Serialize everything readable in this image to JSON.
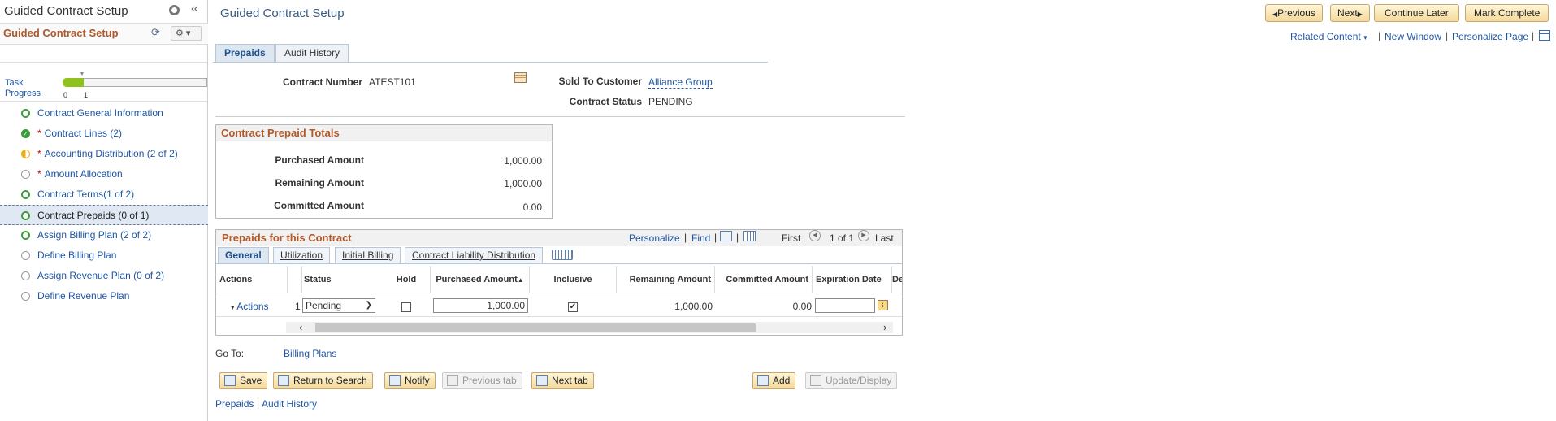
{
  "left_panel": {
    "title": "Guided Contract Setup",
    "subtitle": "Guided Contract Setup",
    "task_progress": {
      "label_line1": "Task",
      "label_line2": "Progress",
      "tick0": "0",
      "tick1": "1"
    },
    "items": [
      {
        "label": "Contract General Information",
        "required": false,
        "status": "open"
      },
      {
        "label": "Contract Lines (2)",
        "required": true,
        "status": "complete"
      },
      {
        "label": "Accounting Distribution (2 of 2)",
        "required": true,
        "status": "partial"
      },
      {
        "label": "Amount Allocation",
        "required": true,
        "status": "notstarted"
      },
      {
        "label": "Contract Terms(1 of 2)",
        "required": false,
        "status": "open"
      },
      {
        "label": "Contract Prepaids (0 of 1)",
        "required": false,
        "status": "open",
        "active": true
      },
      {
        "label": "Assign Billing Plan (2 of 2)",
        "required": false,
        "status": "open"
      },
      {
        "label": "Define Billing Plan",
        "required": false,
        "status": "notstarted"
      },
      {
        "label": "Assign Revenue Plan (0 of 2)",
        "required": false,
        "status": "notstarted"
      },
      {
        "label": "Define Revenue Plan",
        "required": false,
        "status": "notstarted"
      }
    ],
    "required_mark": "*"
  },
  "header": {
    "title": "Guided Contract Setup",
    "previous": "Previous",
    "next": "Next",
    "continue_later": "Continue Later",
    "mark_complete": "Mark Complete",
    "related_content": "Related Content",
    "new_window": "New Window",
    "personalize_page": "Personalize Page"
  },
  "tabs": {
    "prepaids": "Prepaids",
    "audit_history": "Audit History"
  },
  "contract": {
    "number_label": "Contract Number",
    "number": "ATEST101",
    "sold_to_label": "Sold To Customer",
    "sold_to": "Alliance Group",
    "status_label": "Contract Status",
    "status": "PENDING"
  },
  "totals": {
    "title": "Contract Prepaid Totals",
    "purchased_label": "Purchased Amount",
    "purchased": "1,000.00",
    "remaining_label": "Remaining Amount",
    "remaining": "1,000.00",
    "committed_label": "Committed Amount",
    "committed": "0.00"
  },
  "grid": {
    "title": "Prepaids for this Contract",
    "personalize": "Personalize",
    "find": "Find",
    "first": "First",
    "pager": "1 of 1",
    "last": "Last",
    "tabs": [
      "General",
      "Utilization",
      "Initial Billing",
      "Contract Liability Distribution"
    ],
    "columns": {
      "actions": "Actions",
      "status": "Status",
      "hold": "Hold",
      "purchased": "Purchased Amount",
      "inclusive": "Inclusive",
      "remaining": "Remaining Amount",
      "committed": "Committed Amount",
      "expiration": "Expiration Date",
      "overflow": "De"
    },
    "row": {
      "actions": "Actions",
      "num": "1",
      "status": "Pending",
      "hold": false,
      "purchased": "1,000.00",
      "inclusive": true,
      "remaining": "1,000.00",
      "committed": "0.00",
      "expiration": ""
    }
  },
  "goto": {
    "label": "Go To:",
    "link": "Billing Plans"
  },
  "buttons": {
    "save": "Save",
    "return_to_search": "Return to Search",
    "notify": "Notify",
    "previous_tab": "Previous tab",
    "next_tab": "Next tab",
    "add": "Add",
    "update_display": "Update/Display"
  },
  "footer_links": {
    "prepaids": "Prepaids",
    "separator": "|",
    "audit_history": "Audit History"
  },
  "colors": {
    "accent": "#b0592a",
    "link": "#1f56a5",
    "complete": "#3c9c3c",
    "partial": "#e8b21c"
  }
}
